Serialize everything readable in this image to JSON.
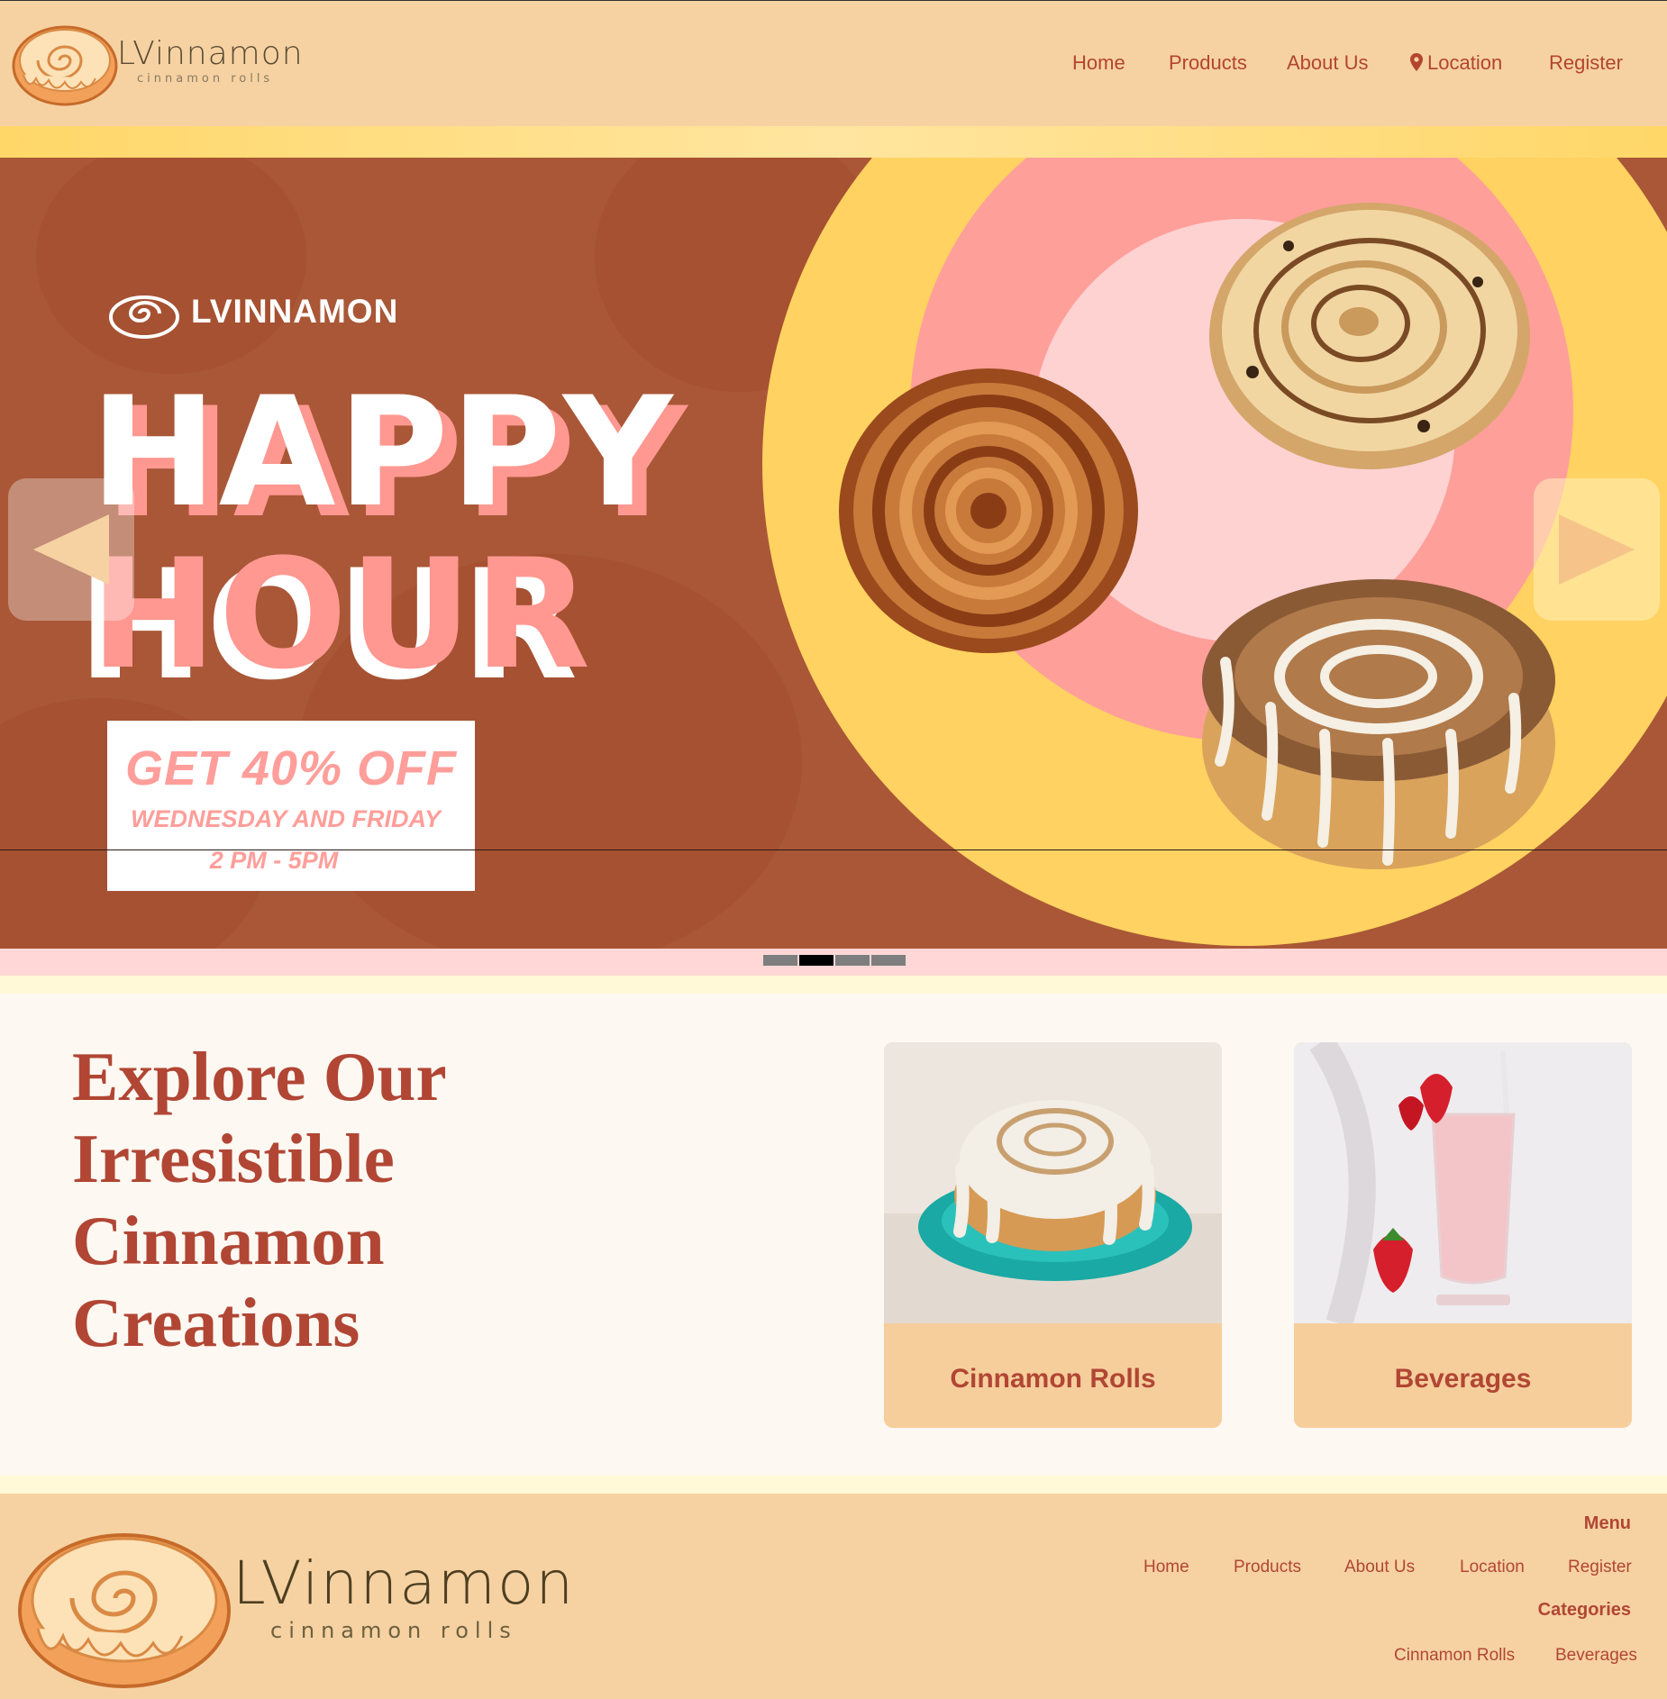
{
  "header": {
    "brand": "LVinnamon",
    "tagline": "cinnamon rolls",
    "nav": [
      "Home",
      "Products",
      "About Us",
      "Location",
      "Register"
    ]
  },
  "hero": {
    "brand": "LVINNAMON",
    "headline_1": "HAPPY",
    "headline_2": "HOUR",
    "promo_1": "GET 40% OFF",
    "promo_2": "WEDNESDAY AND FRIDAY",
    "promo_3": "2 PM - 5PM",
    "slides_total": 4,
    "active_slide": 2
  },
  "explore": {
    "heading": "Explore Our Irresistible Cinnamon Creations",
    "cards": [
      {
        "label": "Cinnamon Rolls"
      },
      {
        "label": "Beverages"
      }
    ]
  },
  "footer": {
    "brand": "LVinnamon",
    "tagline": "cinnamon rolls",
    "menu_heading": "Menu",
    "menu_links": [
      "Home",
      "Products",
      "About Us",
      "Location",
      "Register"
    ],
    "categories_heading": "Categories",
    "category_links": [
      "Cinnamon Rolls",
      "Beverages"
    ]
  },
  "colors": {
    "header_bg": "#f6d2a2",
    "accent": "#b14634",
    "hero_bg": "#a95737",
    "hero_pink": "#ff9891",
    "hero_yellow": "#ffd261"
  }
}
